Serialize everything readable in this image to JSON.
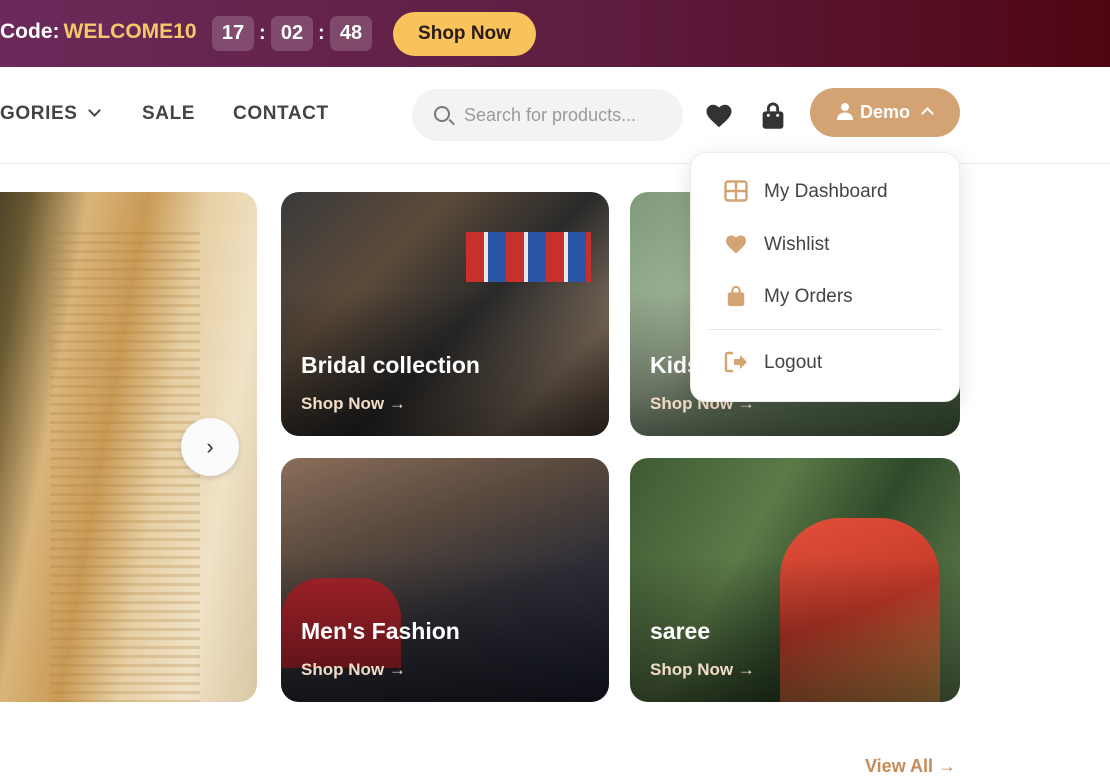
{
  "promo": {
    "code_label": "Code:",
    "code": "WELCOME10",
    "timer": {
      "hours": "17",
      "minutes": "02",
      "seconds": "48",
      "separator": ":"
    },
    "shop_now": "Shop Now"
  },
  "nav": {
    "links": [
      "GORIES",
      "SALE",
      "CONTACT"
    ],
    "search_placeholder": "Search for products...",
    "user_label": "Demo"
  },
  "dropdown": {
    "items": [
      "My Dashboard",
      "Wishlist",
      "My Orders"
    ],
    "logout": "Logout"
  },
  "carousel": {
    "next_glyph": "›"
  },
  "cards": [
    {
      "title": "Bridal collection",
      "cta": "Shop Now →"
    },
    {
      "title": "Kids",
      "cta": "Shop Now →"
    },
    {
      "title": "Men's Fashion",
      "cta": "Shop Now →"
    },
    {
      "title": "saree",
      "cta": "Shop Now →"
    }
  ],
  "view_all": "View All →",
  "colors": {
    "accent": "#d4a373",
    "promo_button": "#f8c35a",
    "promo_code": "#f6c86a"
  }
}
